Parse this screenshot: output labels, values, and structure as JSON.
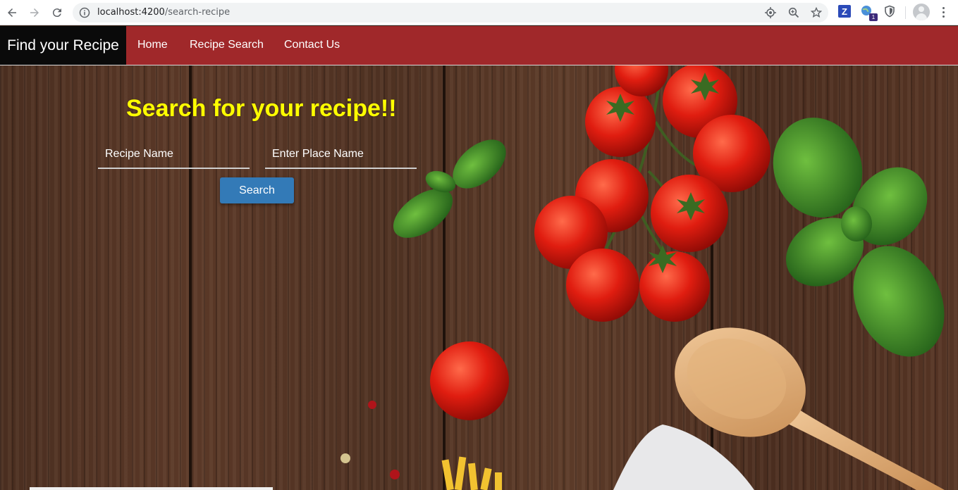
{
  "browser": {
    "url_host": "localhost:4200",
    "url_path": "/search-recipe",
    "extension_badge": "1",
    "extension_z_label": "Z"
  },
  "navbar": {
    "brand": "Find your Recipe",
    "links": [
      "Home",
      "Recipe Search",
      "Contact Us"
    ],
    "bg_color": "#a0282a"
  },
  "search": {
    "title": "Search for your recipe!!",
    "recipe_placeholder": "Recipe Name",
    "place_placeholder": "Enter Place Name",
    "recipe_value": "",
    "place_value": "",
    "button_label": "Search",
    "title_color": "#ffff00",
    "button_color": "#337ab7"
  }
}
